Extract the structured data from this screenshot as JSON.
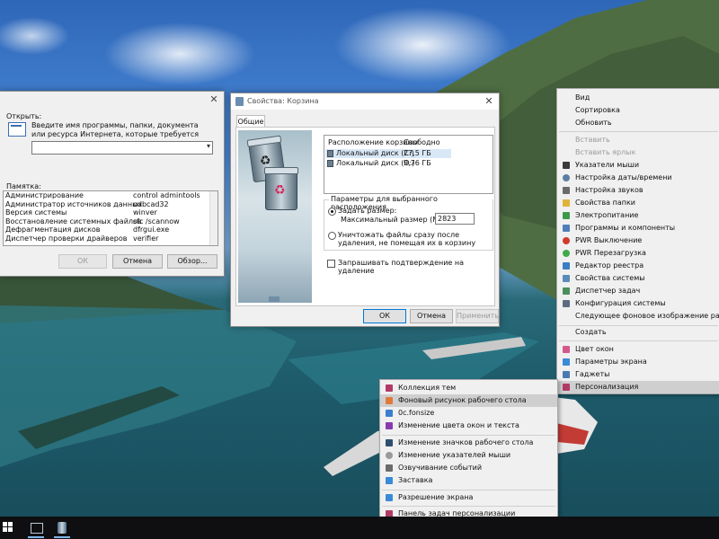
{
  "run_dialog": {
    "open_label": "Открыть:",
    "description": "Введите имя программы, папки, документа или ресурса Интернета, которые требуется открыть.",
    "input_value": "",
    "memo_label": "Памятка:",
    "memo_items": [
      {
        "name": "Администрирование",
        "cmd": "control admintools"
      },
      {
        "name": "Администратор источников данных",
        "cmd": "odbcad32"
      },
      {
        "name": "Версия системы",
        "cmd": "winver"
      },
      {
        "name": "Восстановление системных файлов",
        "cmd": "sfc /scannow"
      },
      {
        "name": "Дефрагментация дисков",
        "cmd": "dfrgui.exe"
      },
      {
        "name": "Диспетчер проверки драйверов",
        "cmd": "verifier"
      }
    ],
    "ok_label": "ОК",
    "cancel_label": "Отмена",
    "browse_label": "Обзор..."
  },
  "props_dialog": {
    "title": "Свойства: Корзина",
    "tab_general": "Общие",
    "col_location": "Расположение корзины",
    "col_free": "Свободно",
    "drives": [
      {
        "name": "Локальный диск (C:)",
        "free": "27,5 ГБ"
      },
      {
        "name": "Локальный диск (D:)",
        "free": "9,76 ГБ"
      }
    ],
    "group_title": "Параметры для выбранного расположения",
    "set_size_label": "Задать размер:",
    "max_size_label": "Максимальный размер (МБ):",
    "max_size_value": "2823",
    "delete_immediately_label": "Уничтожать файлы сразу после удаления, не помещая их в корзину",
    "confirm_label": "Запрашивать подтверждение на удаление",
    "ok_label": "ОК",
    "cancel_label": "Отмена",
    "apply_label": "Применить"
  },
  "desktop_menu": {
    "items": [
      {
        "label": "Вид"
      },
      {
        "label": "Сортировка"
      },
      {
        "label": "Обновить"
      },
      {
        "label": "Вставить"
      },
      {
        "label": "Вставить ярлык"
      },
      {
        "label": "Указатели мыши"
      },
      {
        "label": "Настройка даты/времени"
      },
      {
        "label": "Настройка звуков"
      },
      {
        "label": "Свойства папки"
      },
      {
        "label": "Электропитание"
      },
      {
        "label": "Программы и компоненты"
      },
      {
        "label": "PWR Выключение"
      },
      {
        "label": "PWR Перезагрузка"
      },
      {
        "label": "Редактор реестра"
      },
      {
        "label": "Свойства системы"
      },
      {
        "label": "Диспетчер задач"
      },
      {
        "label": "Конфигурация системы"
      },
      {
        "label": "Следующее фоновое изображение рабочего стола"
      },
      {
        "label": "Создать"
      },
      {
        "label": "Цвет окон"
      },
      {
        "label": "Параметры экрана"
      },
      {
        "label": "Гаджеты"
      },
      {
        "label": "Персонализация"
      }
    ]
  },
  "personalization_menu": {
    "items": [
      {
        "label": "Коллекция тем"
      },
      {
        "label": "Фоновый рисунок рабочего стола"
      },
      {
        "label": "0c.fonsize"
      },
      {
        "label": "Изменение цвета окон и текста"
      },
      {
        "label": "Изменение значков рабочего стола"
      },
      {
        "label": "Изменение указателей мыши"
      },
      {
        "label": "Озвучивание событий"
      },
      {
        "label": "Заставка"
      },
      {
        "label": "Разрешение экрана"
      },
      {
        "label": "Панель задач персонализации"
      }
    ]
  },
  "colors": {
    "accent": "#0078d7",
    "taskbar": "#0f0f12",
    "menu_bg": "#f0f0f0",
    "highlight": "#cfcfcf"
  }
}
